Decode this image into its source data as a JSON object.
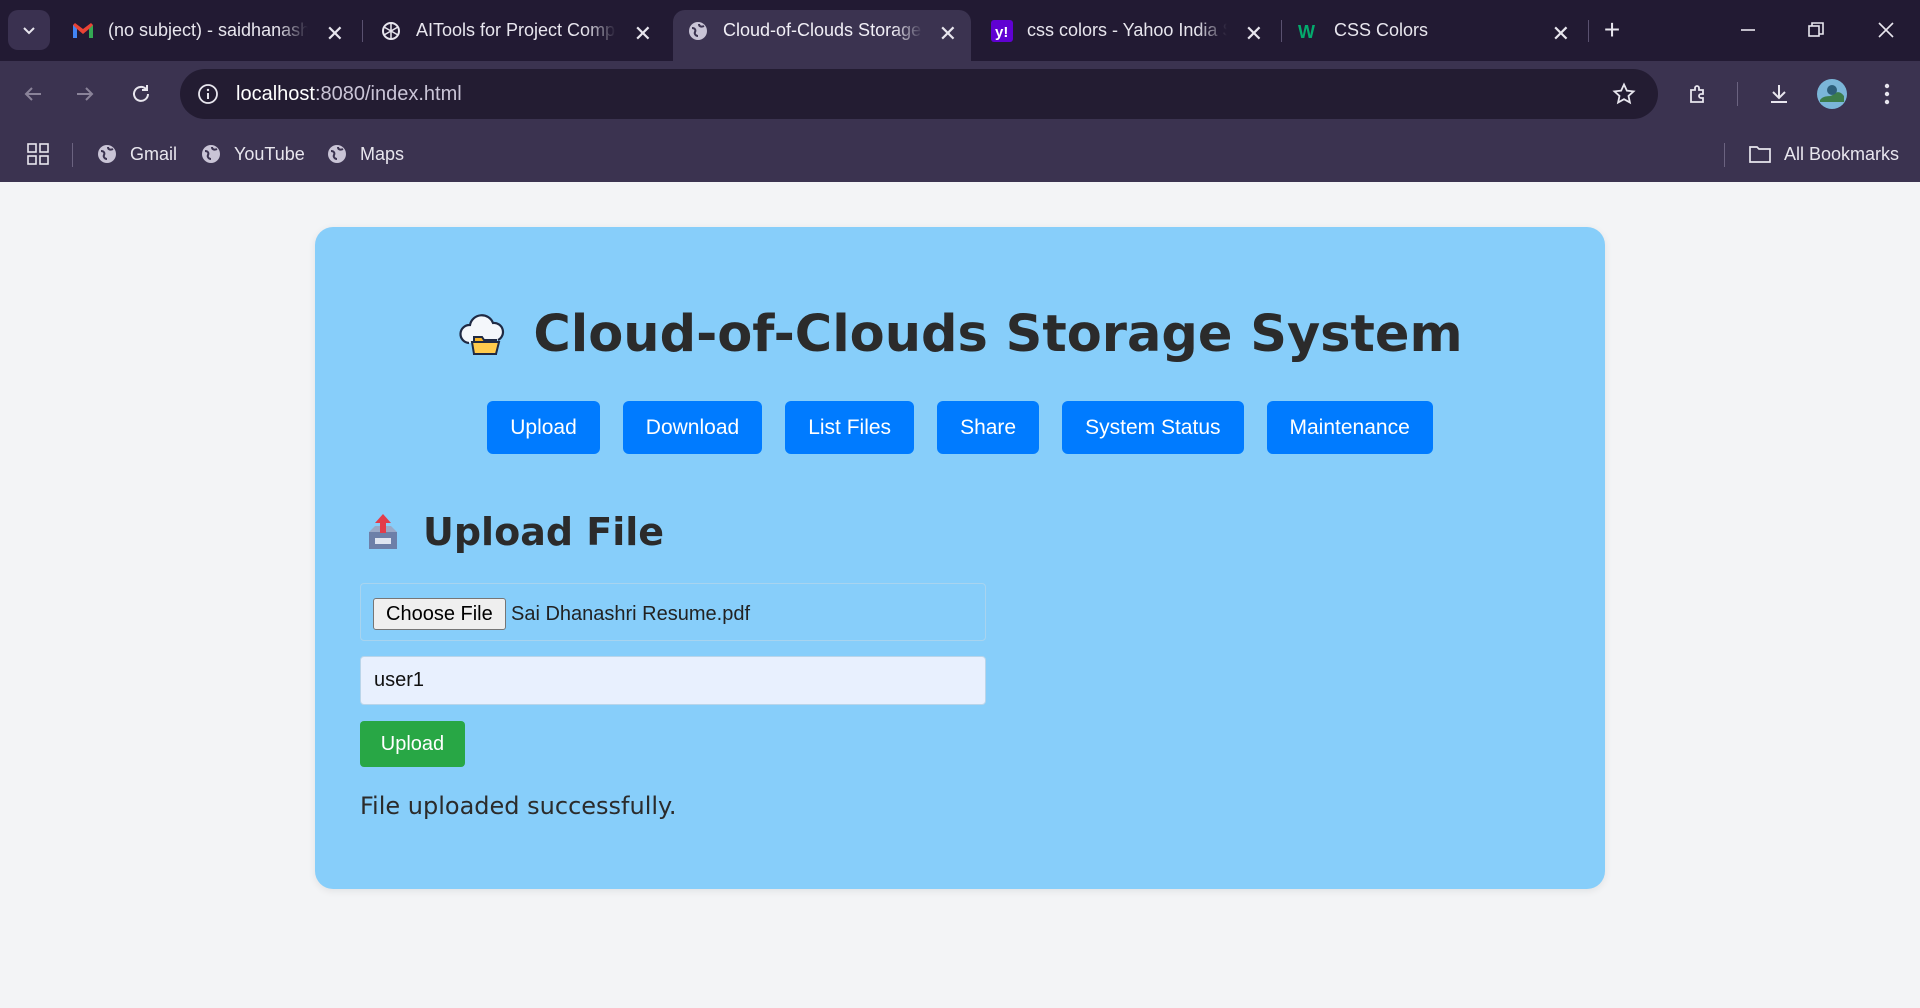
{
  "browser": {
    "tabs": [
      {
        "title": "(no subject) - saidhanashri",
        "favicon": "gmail-icon"
      },
      {
        "title": "AITools for Project Compl",
        "favicon": "openai-icon"
      },
      {
        "title": "Cloud-of-Clouds Storage",
        "favicon": "globe-icon",
        "active": true
      },
      {
        "title": "css colors - Yahoo India S",
        "favicon": "yahoo-icon"
      },
      {
        "title": "CSS Colors",
        "favicon": "w3schools-icon"
      }
    ],
    "url_host": "localhost",
    "url_path": ":8080/index.html",
    "bookmarks": [
      "Gmail",
      "YouTube",
      "Maps"
    ],
    "all_bookmarks_label": "All Bookmarks"
  },
  "page": {
    "title": "Cloud-of-Clouds Storage System",
    "nav": [
      "Upload",
      "Download",
      "List Files",
      "Share",
      "System Status",
      "Maintenance"
    ],
    "section_title": "Upload File",
    "file_input": {
      "button_label": "Choose File",
      "file_name": "Sai Dhanashri Resume.pdf"
    },
    "user_field_value": "user1",
    "submit_label": "Upload",
    "status_message": "File uploaded successfully."
  },
  "colors": {
    "card_bg": "#87cefa",
    "nav_button": "#007bff",
    "submit_button": "#28a745",
    "chrome_dark": "#221a33",
    "chrome_toolbar": "#3b3350"
  }
}
